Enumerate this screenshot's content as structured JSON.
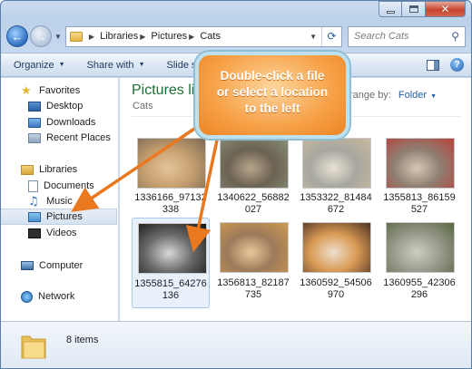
{
  "window": {
    "caption_buttons": {
      "minimize": "minimize",
      "maximize": "maximize",
      "close": "✕"
    }
  },
  "address_bar": {
    "breadcrumbs": [
      "Libraries",
      "Pictures",
      "Cats"
    ],
    "search_placeholder": "Search Cats"
  },
  "command_bar": {
    "items": [
      "Organize",
      "Share with",
      "Slide show"
    ]
  },
  "navigation_pane": {
    "favorites": {
      "label": "Favorites",
      "items": [
        "Desktop",
        "Downloads",
        "Recent Places"
      ]
    },
    "libraries": {
      "label": "Libraries",
      "items": [
        "Documents",
        "Music",
        "Pictures",
        "Videos"
      ],
      "selected": "Pictures"
    },
    "computer": "Computer",
    "network": "Network"
  },
  "content": {
    "library_title": "Pictures library",
    "library_subtitle": "Cats",
    "arrange_label": "Arrange by:",
    "arrange_value": "Folder",
    "files": [
      {
        "name": "1336166_97132338",
        "thumb_colors": [
          "#7a6a55",
          "#c8a070",
          "#e2c49a"
        ],
        "selected": false
      },
      {
        "name": "1340622_56882027",
        "thumb_colors": [
          "#8a8f7a",
          "#6b6252",
          "#b8a58a"
        ],
        "selected": false
      },
      {
        "name": "1353322_81484672",
        "thumb_colors": [
          "#c9b89d",
          "#a7a7a0",
          "#e9e2d4"
        ],
        "selected": false
      },
      {
        "name": "1355813_86159527",
        "thumb_colors": [
          "#b8423b",
          "#8e7f72",
          "#d6c7b5"
        ],
        "selected": false
      },
      {
        "name": "1355815_64276136",
        "thumb_colors": [
          "#151515",
          "#6a6a6a",
          "#d8d8d8"
        ],
        "selected": true
      },
      {
        "name": "1356813_82187735",
        "thumb_colors": [
          "#cf9a50",
          "#9c7a5a",
          "#e8c99a"
        ],
        "selected": false
      },
      {
        "name": "1360592_54506970",
        "thumb_colors": [
          "#4c2f23",
          "#d99b55",
          "#eedfcf"
        ],
        "selected": false
      },
      {
        "name": "1360955_42306296",
        "thumb_colors": [
          "#57663f",
          "#9a9a8e",
          "#cfcfc0"
        ],
        "selected": false
      }
    ]
  },
  "details_pane": {
    "item_count": "8 items"
  },
  "callout": {
    "lines": [
      "Double-click a file",
      "or select a location",
      "to the left"
    ],
    "color": "#f39a3e",
    "arrow_color": "#e9781f"
  }
}
